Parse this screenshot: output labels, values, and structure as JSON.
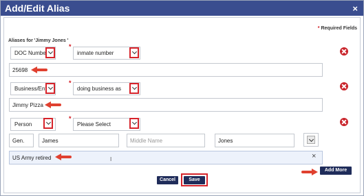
{
  "dialog": {
    "title": "Add/Edit Alias",
    "close_glyph": "×"
  },
  "required_note": {
    "star": "*",
    "text": "Required Fields"
  },
  "section_label": "Aliases for 'Jimmy Jones '",
  "required_star": "*",
  "aliases": [
    {
      "type_select": "DOC Number",
      "sub_select": "inmate number",
      "value": "25698"
    },
    {
      "type_select": "Business/Entity",
      "sub_select": "doing business as",
      "value": "Jimmy Pizza"
    },
    {
      "type_select": "Person",
      "sub_select": "Please Select",
      "name": {
        "generation": "Gen.",
        "first": "James",
        "middle_placeholder": "Middle Name",
        "last": "Jones"
      },
      "value": "US Army retired"
    }
  ],
  "clear_glyph": "×",
  "text_cursor": "I",
  "buttons": {
    "add_more": "Add More",
    "cancel": "Cancel",
    "save": "Save"
  },
  "icons": {
    "remove": "remove-circle-icon",
    "dropdown": "chevron-down-icon",
    "annotation": "red-arrow-icon"
  },
  "colors": {
    "titlebar": "#3a4d8f",
    "button": "#1f2c5a",
    "annotation_red": "#e0402f",
    "highlight_red": "#d6232a"
  }
}
